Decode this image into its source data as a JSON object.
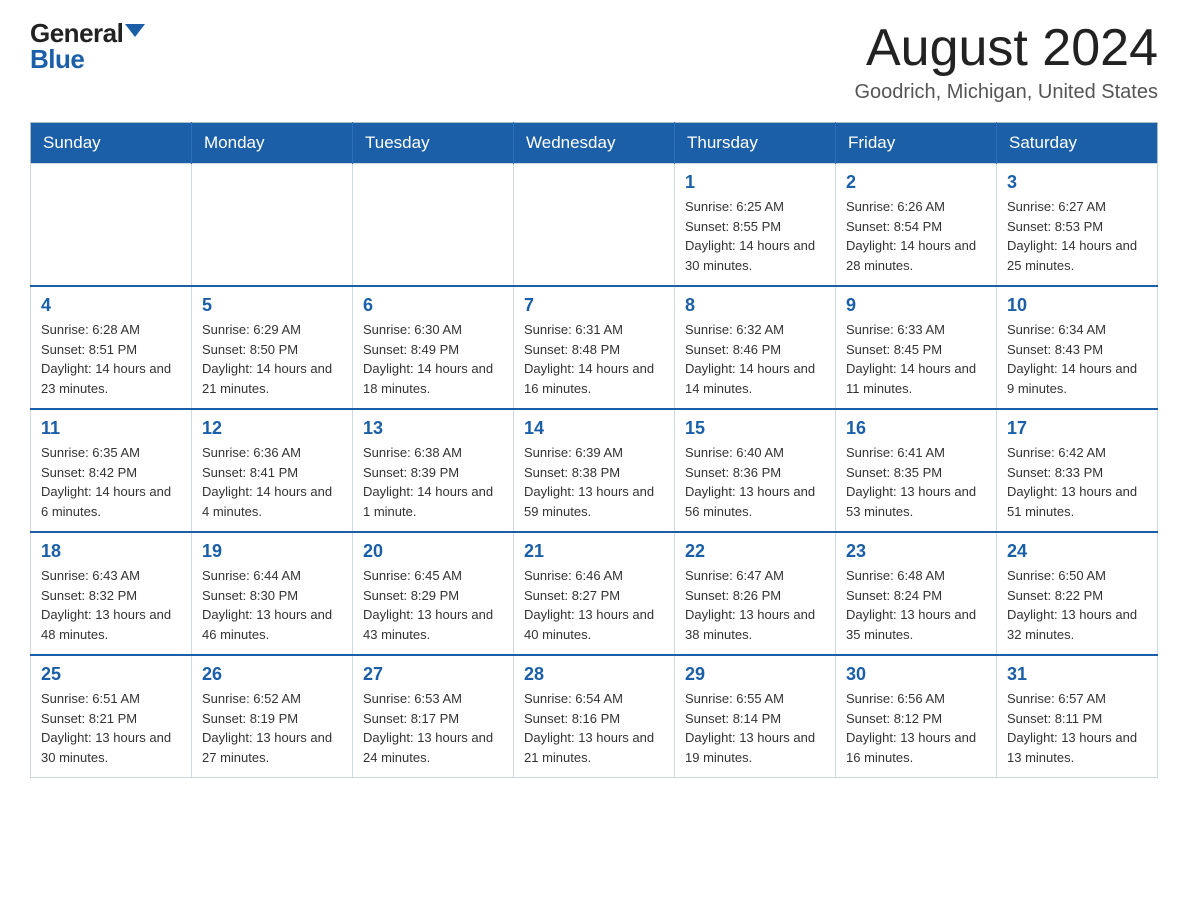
{
  "logo": {
    "general": "General",
    "blue": "Blue"
  },
  "title": "August 2024",
  "subtitle": "Goodrich, Michigan, United States",
  "days_of_week": [
    "Sunday",
    "Monday",
    "Tuesday",
    "Wednesday",
    "Thursday",
    "Friday",
    "Saturday"
  ],
  "weeks": [
    [
      {
        "day": "",
        "info": ""
      },
      {
        "day": "",
        "info": ""
      },
      {
        "day": "",
        "info": ""
      },
      {
        "day": "",
        "info": ""
      },
      {
        "day": "1",
        "info": "Sunrise: 6:25 AM\nSunset: 8:55 PM\nDaylight: 14 hours and 30 minutes."
      },
      {
        "day": "2",
        "info": "Sunrise: 6:26 AM\nSunset: 8:54 PM\nDaylight: 14 hours and 28 minutes."
      },
      {
        "day": "3",
        "info": "Sunrise: 6:27 AM\nSunset: 8:53 PM\nDaylight: 14 hours and 25 minutes."
      }
    ],
    [
      {
        "day": "4",
        "info": "Sunrise: 6:28 AM\nSunset: 8:51 PM\nDaylight: 14 hours and 23 minutes."
      },
      {
        "day": "5",
        "info": "Sunrise: 6:29 AM\nSunset: 8:50 PM\nDaylight: 14 hours and 21 minutes."
      },
      {
        "day": "6",
        "info": "Sunrise: 6:30 AM\nSunset: 8:49 PM\nDaylight: 14 hours and 18 minutes."
      },
      {
        "day": "7",
        "info": "Sunrise: 6:31 AM\nSunset: 8:48 PM\nDaylight: 14 hours and 16 minutes."
      },
      {
        "day": "8",
        "info": "Sunrise: 6:32 AM\nSunset: 8:46 PM\nDaylight: 14 hours and 14 minutes."
      },
      {
        "day": "9",
        "info": "Sunrise: 6:33 AM\nSunset: 8:45 PM\nDaylight: 14 hours and 11 minutes."
      },
      {
        "day": "10",
        "info": "Sunrise: 6:34 AM\nSunset: 8:43 PM\nDaylight: 14 hours and 9 minutes."
      }
    ],
    [
      {
        "day": "11",
        "info": "Sunrise: 6:35 AM\nSunset: 8:42 PM\nDaylight: 14 hours and 6 minutes."
      },
      {
        "day": "12",
        "info": "Sunrise: 6:36 AM\nSunset: 8:41 PM\nDaylight: 14 hours and 4 minutes."
      },
      {
        "day": "13",
        "info": "Sunrise: 6:38 AM\nSunset: 8:39 PM\nDaylight: 14 hours and 1 minute."
      },
      {
        "day": "14",
        "info": "Sunrise: 6:39 AM\nSunset: 8:38 PM\nDaylight: 13 hours and 59 minutes."
      },
      {
        "day": "15",
        "info": "Sunrise: 6:40 AM\nSunset: 8:36 PM\nDaylight: 13 hours and 56 minutes."
      },
      {
        "day": "16",
        "info": "Sunrise: 6:41 AM\nSunset: 8:35 PM\nDaylight: 13 hours and 53 minutes."
      },
      {
        "day": "17",
        "info": "Sunrise: 6:42 AM\nSunset: 8:33 PM\nDaylight: 13 hours and 51 minutes."
      }
    ],
    [
      {
        "day": "18",
        "info": "Sunrise: 6:43 AM\nSunset: 8:32 PM\nDaylight: 13 hours and 48 minutes."
      },
      {
        "day": "19",
        "info": "Sunrise: 6:44 AM\nSunset: 8:30 PM\nDaylight: 13 hours and 46 minutes."
      },
      {
        "day": "20",
        "info": "Sunrise: 6:45 AM\nSunset: 8:29 PM\nDaylight: 13 hours and 43 minutes."
      },
      {
        "day": "21",
        "info": "Sunrise: 6:46 AM\nSunset: 8:27 PM\nDaylight: 13 hours and 40 minutes."
      },
      {
        "day": "22",
        "info": "Sunrise: 6:47 AM\nSunset: 8:26 PM\nDaylight: 13 hours and 38 minutes."
      },
      {
        "day": "23",
        "info": "Sunrise: 6:48 AM\nSunset: 8:24 PM\nDaylight: 13 hours and 35 minutes."
      },
      {
        "day": "24",
        "info": "Sunrise: 6:50 AM\nSunset: 8:22 PM\nDaylight: 13 hours and 32 minutes."
      }
    ],
    [
      {
        "day": "25",
        "info": "Sunrise: 6:51 AM\nSunset: 8:21 PM\nDaylight: 13 hours and 30 minutes."
      },
      {
        "day": "26",
        "info": "Sunrise: 6:52 AM\nSunset: 8:19 PM\nDaylight: 13 hours and 27 minutes."
      },
      {
        "day": "27",
        "info": "Sunrise: 6:53 AM\nSunset: 8:17 PM\nDaylight: 13 hours and 24 minutes."
      },
      {
        "day": "28",
        "info": "Sunrise: 6:54 AM\nSunset: 8:16 PM\nDaylight: 13 hours and 21 minutes."
      },
      {
        "day": "29",
        "info": "Sunrise: 6:55 AM\nSunset: 8:14 PM\nDaylight: 13 hours and 19 minutes."
      },
      {
        "day": "30",
        "info": "Sunrise: 6:56 AM\nSunset: 8:12 PM\nDaylight: 13 hours and 16 minutes."
      },
      {
        "day": "31",
        "info": "Sunrise: 6:57 AM\nSunset: 8:11 PM\nDaylight: 13 hours and 13 minutes."
      }
    ]
  ]
}
